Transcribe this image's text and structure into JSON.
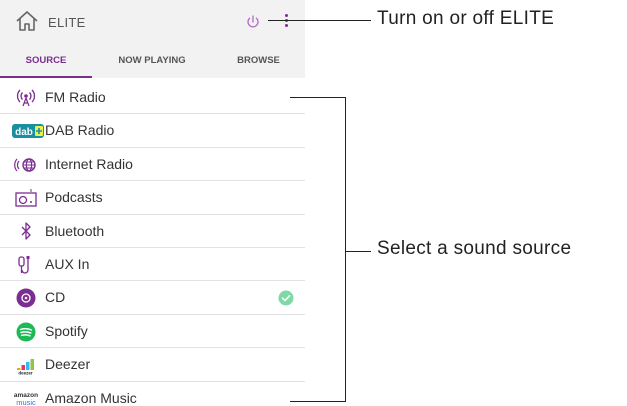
{
  "app": {
    "title": "ELITE"
  },
  "tabs": [
    {
      "label": "SOURCE",
      "active": true
    },
    {
      "label": "NOW PLAYING",
      "active": false
    },
    {
      "label": "BROWSE",
      "active": false
    }
  ],
  "sources": [
    {
      "label": "FM Radio",
      "icon": "fm-radio-icon"
    },
    {
      "label": "DAB Radio",
      "icon": "dab-radio-icon"
    },
    {
      "label": "Internet Radio",
      "icon": "internet-radio-icon"
    },
    {
      "label": "Podcasts",
      "icon": "podcasts-icon"
    },
    {
      "label": "Bluetooth",
      "icon": "bluetooth-icon"
    },
    {
      "label": "AUX In",
      "icon": "aux-in-icon"
    },
    {
      "label": "CD",
      "icon": "cd-icon",
      "selected": true
    },
    {
      "label": "Spotify",
      "icon": "spotify-icon"
    },
    {
      "label": "Deezer",
      "icon": "deezer-icon"
    },
    {
      "label": "Amazon Music",
      "icon": "amazon-music-icon"
    }
  ],
  "icon_text": {
    "dab": "dab",
    "deezer": "deezer",
    "amazon_1": "amazon",
    "amazon_2": "music"
  },
  "callouts": {
    "power": "Turn on or off ELITE",
    "source": "Select a sound source"
  },
  "colors": {
    "accent": "#7b2d91",
    "check": "#7ed9a6",
    "spotify": "#1db954",
    "dab_badge": "#1a8fa0"
  }
}
